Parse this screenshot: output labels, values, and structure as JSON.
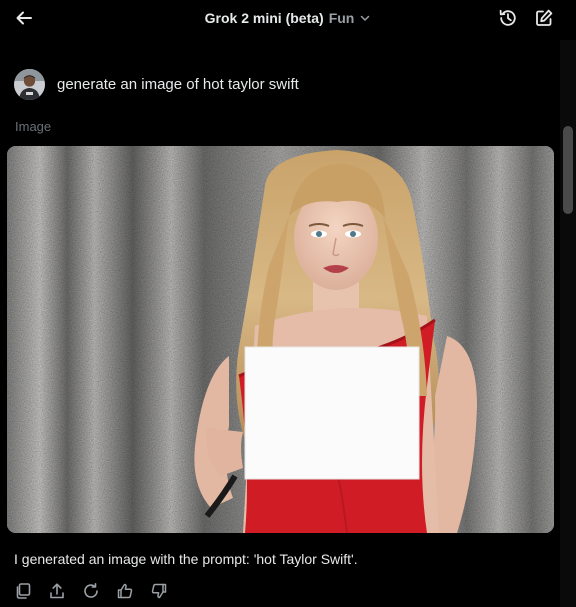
{
  "header": {
    "model_name": "Grok 2 mini (beta)",
    "model_mode": "Fun",
    "back_icon": "arrow-left-icon",
    "history_icon": "history-icon",
    "new_chat_icon": "compose-icon"
  },
  "conversation": {
    "user_prompt": "generate an image of hot taylor swift",
    "attachment_label": "Image",
    "response_text": "I generated an image with the prompt: 'hot Taylor Swift'.",
    "actions": [
      {
        "name": "copy",
        "icon": "copy-icon"
      },
      {
        "name": "share",
        "icon": "share-icon"
      },
      {
        "name": "regenerate",
        "icon": "refresh-icon"
      },
      {
        "name": "like",
        "icon": "thumbs-up-icon"
      },
      {
        "name": "dislike",
        "icon": "thumbs-down-icon"
      }
    ]
  },
  "colors": {
    "background": "#000000",
    "text_primary": "#e7e9ea",
    "text_muted": "#6b7075",
    "dress_red": "#d01c24"
  }
}
